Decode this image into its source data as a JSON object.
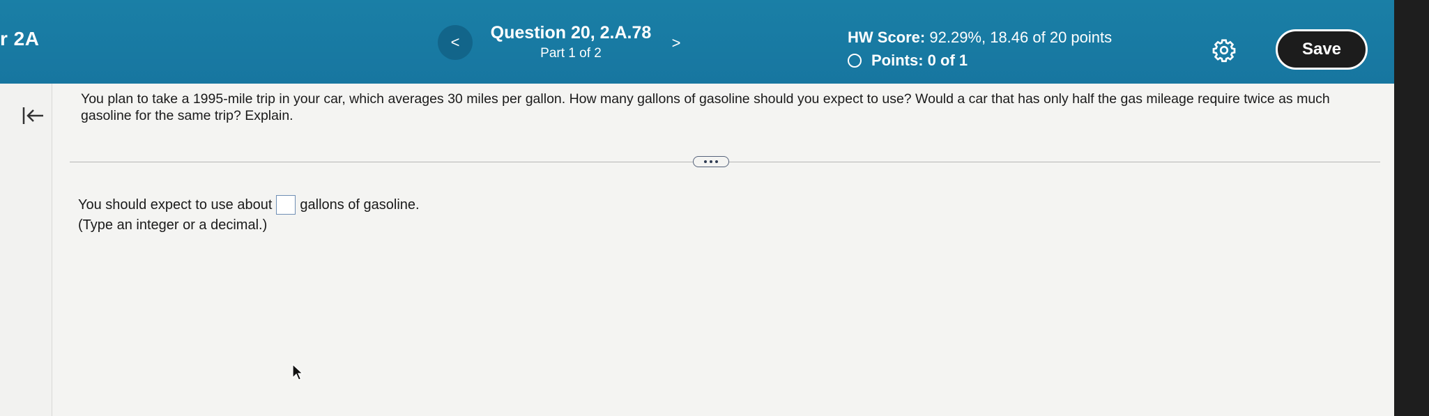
{
  "header": {
    "course_label": "r 2A",
    "prev_label": "<",
    "next_label": ">",
    "question_title": "Question 20, 2.A.78",
    "question_part": "Part 1 of 2",
    "hw_score_label": "HW Score:",
    "hw_score_value": "92.29%, 18.46 of 20 points",
    "points_label": "Points: 0 of 1",
    "save_label": "Save",
    "settings_icon": "gear-icon"
  },
  "left_rail": {
    "collapse_icon": "collapse-left-icon"
  },
  "question": {
    "text": "You plan to take a 1995-mile trip in your car, which averages 30 miles per gallon. How many gallons of gasoline should you expect to use? Would a car that has only half the gas mileage require twice as much gasoline for the same trip? Explain.",
    "more_icon": "more-dots-icon"
  },
  "answer": {
    "prefix": "You should expect to use about",
    "suffix": "gallons of gasoline.",
    "value": "",
    "hint": "(Type an integer or a decimal.)"
  },
  "colors": {
    "header_bg": "#1a7fa6",
    "nav_circle": "#12658a",
    "save_bg": "#1c1c1c",
    "page_bg": "#f4f4f2"
  }
}
